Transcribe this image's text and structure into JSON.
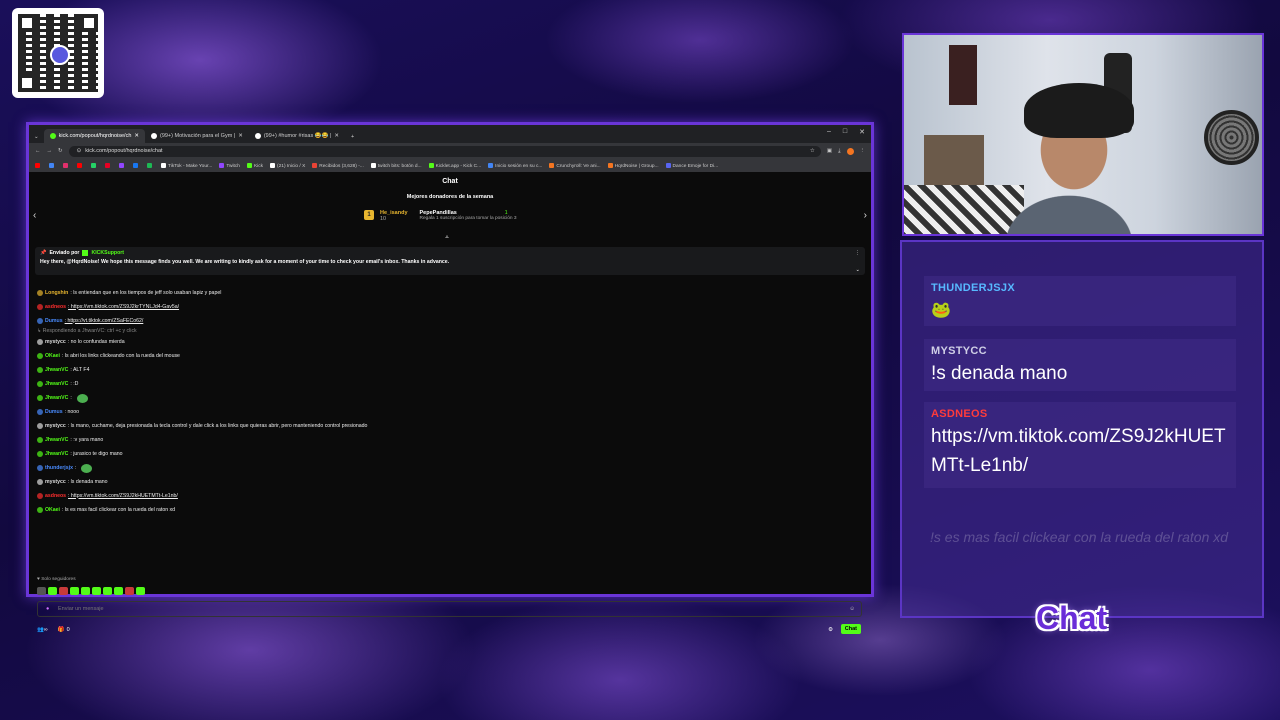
{
  "browser": {
    "tabs": [
      {
        "label": "kick.com/popout/hqrdnoise/ch",
        "color": "#53fc18",
        "active": true
      },
      {
        "label": "(99+) Motivación para el Gym |",
        "color": "#ffffff",
        "active": false
      },
      {
        "label": "(99+) #humor #risas 😂😂 |",
        "color": "#ffffff",
        "active": false
      }
    ],
    "new_tab": "+",
    "window_controls": [
      "–",
      "□",
      "✕"
    ],
    "url": "kick.com/popout/hqrdnoise/chat",
    "bookmarks": [
      {
        "label": "",
        "color": "#ff0000"
      },
      {
        "label": "",
        "color": "#4285f4"
      },
      {
        "label": "",
        "color": "#e1306c"
      },
      {
        "label": "",
        "color": "#ff0000"
      },
      {
        "label": "",
        "color": "#25d366"
      },
      {
        "label": "",
        "color": "#e60023"
      },
      {
        "label": "",
        "color": "#9146ff"
      },
      {
        "label": "",
        "color": "#1877f2"
      },
      {
        "label": "",
        "color": "#1db954"
      },
      {
        "label": "TikTok - Make Your...",
        "color": "#ffffff"
      },
      {
        "label": "Twitch",
        "color": "#9146ff"
      },
      {
        "label": "Kick",
        "color": "#53fc18"
      },
      {
        "label": "(21) Inicio / X",
        "color": "#ffffff"
      },
      {
        "label": "Recibidos (3,628) -...",
        "color": "#ea4335"
      },
      {
        "label": "twitch bits: botón d...",
        "color": "#ffffff"
      },
      {
        "label": "Kicklet.app - Kick C...",
        "color": "#53fc18"
      },
      {
        "label": "Inicio sesión en su c...",
        "color": "#4285f4"
      },
      {
        "label": "Crunchyroll: Ve ani...",
        "color": "#f47521"
      },
      {
        "label": "HqrdNoise | Group...",
        "color": "#f47521"
      },
      {
        "label": "Dance Emoje for Di...",
        "color": "#5865f2"
      }
    ]
  },
  "chat": {
    "title": "Chat",
    "donors_heading": "Mejores donadores de la semana",
    "donor1": {
      "rank": "1",
      "name": "He_isandy",
      "amount": "10"
    },
    "donor2": {
      "name": "PepePandillas",
      "sub_text": "Regala 1 suscripción para tomar la posición 3",
      "amount": "1"
    },
    "pinned": {
      "label": "Enviado por",
      "sender": "KICKSupport",
      "text": "Hey there, @HqrdNoise! We hope this message finds you well. We are writing to kindly ask for a moment of your time to check your email's inbox. Thanks in advance."
    },
    "messages": [
      {
        "name": "Longshin",
        "name_color": "#e7b52f",
        "text": ": ls entiendan que en los tiempos de jeff solo usaban lapiz y papel",
        "link": false
      },
      {
        "name": "asdneos",
        "name_color": "#ff2e2e",
        "text": ": https://vm.tiktok.com/ZS9J2krTYNLJd4-Gav5a/",
        "link": true
      },
      {
        "name": "Dumus",
        "name_color": "#4a8cff",
        "text": ": https://vt.tiktok.com/ZSaFECo62/",
        "link": true
      },
      {
        "name": "",
        "name_color": "#888888",
        "text": "↳ Respondiendo a JhwanVC: ctrl +c y click",
        "link": false,
        "reply": true
      },
      {
        "name": "mystycc",
        "name_color": "#dddddd",
        "text": ": no lo confundas mierda",
        "link": false
      },
      {
        "name": "OKaei",
        "name_color": "#53fc18",
        "text": ": ls abri los links clickeando con la rueda del mouse",
        "link": false
      },
      {
        "name": "JhwanVC",
        "name_color": "#53fc18",
        "text": ": ALT F4",
        "link": false
      },
      {
        "name": "JhwanVC",
        "name_color": "#53fc18",
        "text": ": :D",
        "link": false
      },
      {
        "name": "JhwanVC",
        "name_color": "#53fc18",
        "text": ":",
        "link": false,
        "emote": true
      },
      {
        "name": "Dumus",
        "name_color": "#4a8cff",
        "text": ": nooo",
        "link": false
      },
      {
        "name": "mystycc",
        "name_color": "#dddddd",
        "text": ": ls mano, cuchame, deja presionada la tecla control y dale click a los links que quieras abrir, pero manteniendo control presionado",
        "link": false
      },
      {
        "name": "JhwanVC",
        "name_color": "#53fc18",
        "text": ": :v yara mano",
        "link": false
      },
      {
        "name": "JhwanVC",
        "name_color": "#53fc18",
        "text": ": jurasico te digo mano",
        "link": false
      },
      {
        "name": "thunderjsjx",
        "name_color": "#4a8cff",
        "text": ":",
        "link": false,
        "emote": true
      },
      {
        "name": "mystycc",
        "name_color": "#dddddd",
        "text": ": ls denada mano",
        "link": false
      },
      {
        "name": "asdneos",
        "name_color": "#ff2e2e",
        "text": ": https://vm.tiktok.com/ZS9J2kHUETMTt-Le1nb/",
        "link": true
      },
      {
        "name": "OKaei",
        "name_color": "#53fc18",
        "text": ": ls es mas facil clickear con la rueda del raton xd",
        "link": false
      }
    ],
    "followers_only": "Solo seguidores",
    "input_placeholder": "Enviar un mensaje",
    "viewer_count": "0",
    "gift_count": "0",
    "chat_button": "Chat"
  },
  "overlay": {
    "messages": [
      {
        "user": "THUNDERJSJX",
        "user_color": "#57b9ff",
        "text": "🐸"
      },
      {
        "user": "MYSTYCC",
        "user_color": "#cfcfe6",
        "text": "!s denada mano"
      },
      {
        "user": "ASDNEOS",
        "user_color": "#ff3b3b",
        "text": "https://vm.tiktok.com/ZS9J2kHUETMTt-Le1nb/"
      }
    ],
    "faded_text": "!s es mas facil clickear con la rueda del raton xd",
    "title": "Chat"
  },
  "colors": {
    "accent": "#6a35d8",
    "kick_green": "#53fc18"
  }
}
